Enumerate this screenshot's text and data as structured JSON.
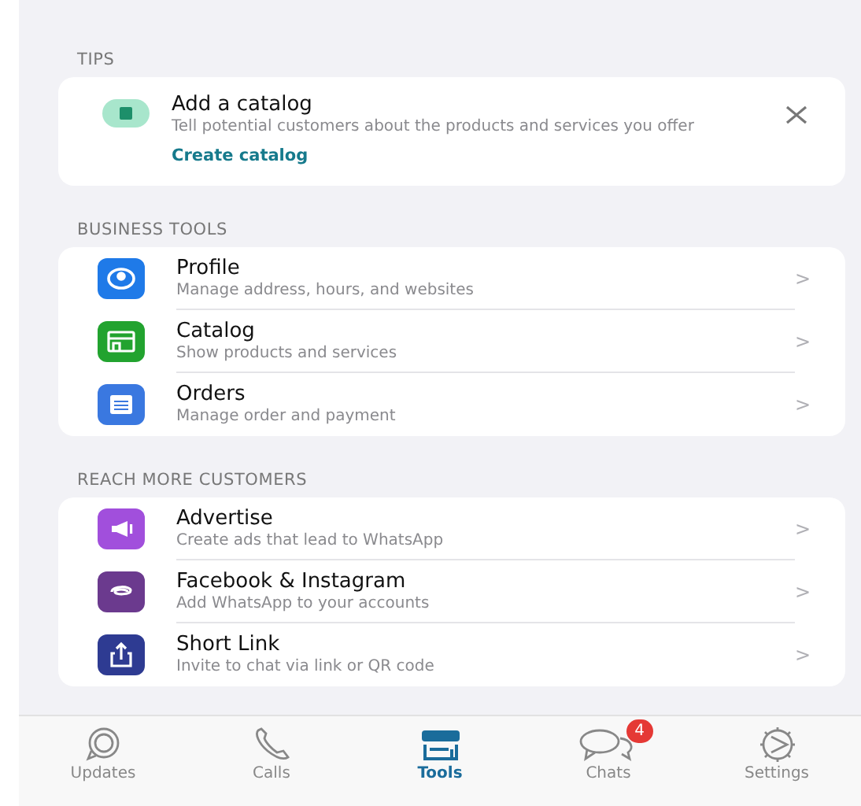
{
  "tips": {
    "header": "TIPS",
    "card": {
      "title": "Add a catalog",
      "description": "Tell potential customers about the products and services you offer",
      "link": "Create catalog"
    }
  },
  "sections": [
    {
      "header": "BUSINESS TOOLS",
      "items": [
        {
          "kind": "profile",
          "color": "#1f7ae8",
          "title": "Profile",
          "subtitle": "Manage address, hours, and websites",
          "chevron": ">"
        },
        {
          "kind": "catalog",
          "color": "#22a32f",
          "title": "Catalog",
          "subtitle": "Show products and services",
          "chevron": ">"
        },
        {
          "kind": "orders",
          "color": "#3a78e0",
          "title": "Orders",
          "subtitle": "Manage order and payment",
          "chevron": ">"
        }
      ]
    },
    {
      "header": "REACH MORE CUSTOMERS",
      "items": [
        {
          "kind": "advertise",
          "color": "#a14fdc",
          "title": "Advertise",
          "subtitle": "Create ads that lead to WhatsApp",
          "chevron": ">"
        },
        {
          "kind": "link-accounts",
          "color": "#6b3a8e",
          "title": "Facebook & Instagram",
          "subtitle": "Add WhatsApp to your accounts",
          "chevron": ">"
        },
        {
          "kind": "share",
          "color": "#2e3b92",
          "title": "Short Link",
          "subtitle": "Invite to chat via link or QR code",
          "chevron": ">"
        }
      ]
    }
  ],
  "tabs": [
    {
      "kind": "updates",
      "label": "Updates",
      "selected": false
    },
    {
      "kind": "calls",
      "label": "Calls",
      "selected": false
    },
    {
      "kind": "tools",
      "label": "Tools",
      "selected": true
    },
    {
      "kind": "chats",
      "label": "Chats",
      "selected": false,
      "badge": "4"
    },
    {
      "kind": "settings",
      "label": "Settings",
      "selected": false
    }
  ]
}
